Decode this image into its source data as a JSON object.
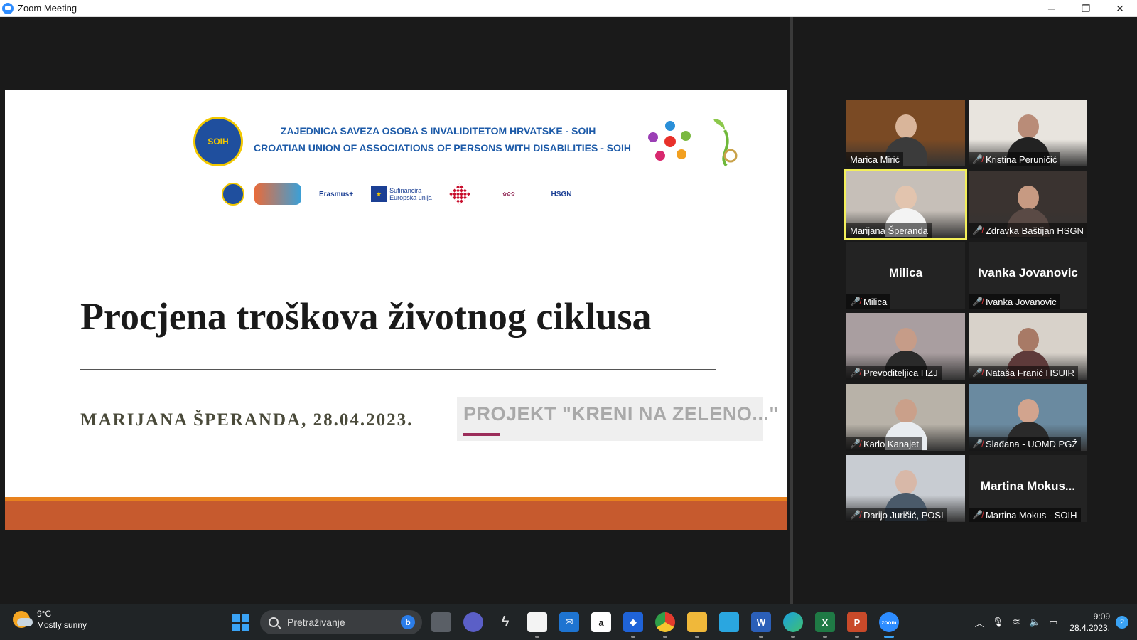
{
  "window": {
    "title": "Zoom Meeting",
    "minimize": "─",
    "restore": "❐",
    "close": "✕"
  },
  "slide": {
    "org_line1": "ZAJEDNICA SAVEZA OSOBA S INVALIDITETOM HRVATSKE - SOIH",
    "org_line2": "CROATIAN UNION OF ASSOCIATIONS OF PERSONS WITH DISABILITIES - SOIH",
    "org_logo_text": "SOIH",
    "partners": {
      "erasmus": "Erasmus+",
      "eu": "Sufinancira Europska unija",
      "hsgn": "HSGN"
    },
    "title": "Procjena troškova životnog ciklusa",
    "author_date": "MARIJANA ŠPERANDA, 28.04.2023.",
    "project": "PROJEKT \"KRENI NA ZELENO...\"",
    "colors": {
      "accent_orange": "#e8821e",
      "band": "#c65a2e",
      "org_blue": "#1c5aa8"
    }
  },
  "participants": [
    {
      "name": "Marica Mirić",
      "muted": false,
      "video": true,
      "active": false
    },
    {
      "name": "Kristina Peruničić",
      "muted": true,
      "video": true,
      "active": false
    },
    {
      "name": "Marijana Šperanda",
      "muted": false,
      "video": true,
      "active": true
    },
    {
      "name": "Zdravka Baštijan HSGN",
      "muted": true,
      "video": true,
      "active": false
    },
    {
      "name": "Milica",
      "display": "Milica",
      "muted": true,
      "video": false,
      "active": false
    },
    {
      "name": "Ivanka Jovanovic",
      "display": "Ivanka Jovanovic",
      "muted": true,
      "video": false,
      "active": false
    },
    {
      "name": "Prevoditeljica HZJ",
      "muted": true,
      "video": true,
      "active": false
    },
    {
      "name": "Nataša Franić HSUIR",
      "muted": true,
      "video": true,
      "active": false
    },
    {
      "name": "Karlo Kanajet",
      "muted": true,
      "video": true,
      "active": false
    },
    {
      "name": "Slađana - UOMD PGŽ",
      "muted": true,
      "video": true,
      "active": false
    },
    {
      "name": "Darijo Jurišić, POSI",
      "muted": true,
      "video": true,
      "active": false
    },
    {
      "name": "Martina Mokus - SOIH",
      "display": "Martina Mokus...",
      "muted": true,
      "video": false,
      "active": false
    }
  ],
  "taskbar": {
    "weather_temp": "9°C",
    "weather_desc": "Mostly sunny",
    "search_placeholder": "Pretraživanje",
    "bing": "b",
    "time": "9:09",
    "date": "28.4.2023.",
    "notifications": "2"
  }
}
